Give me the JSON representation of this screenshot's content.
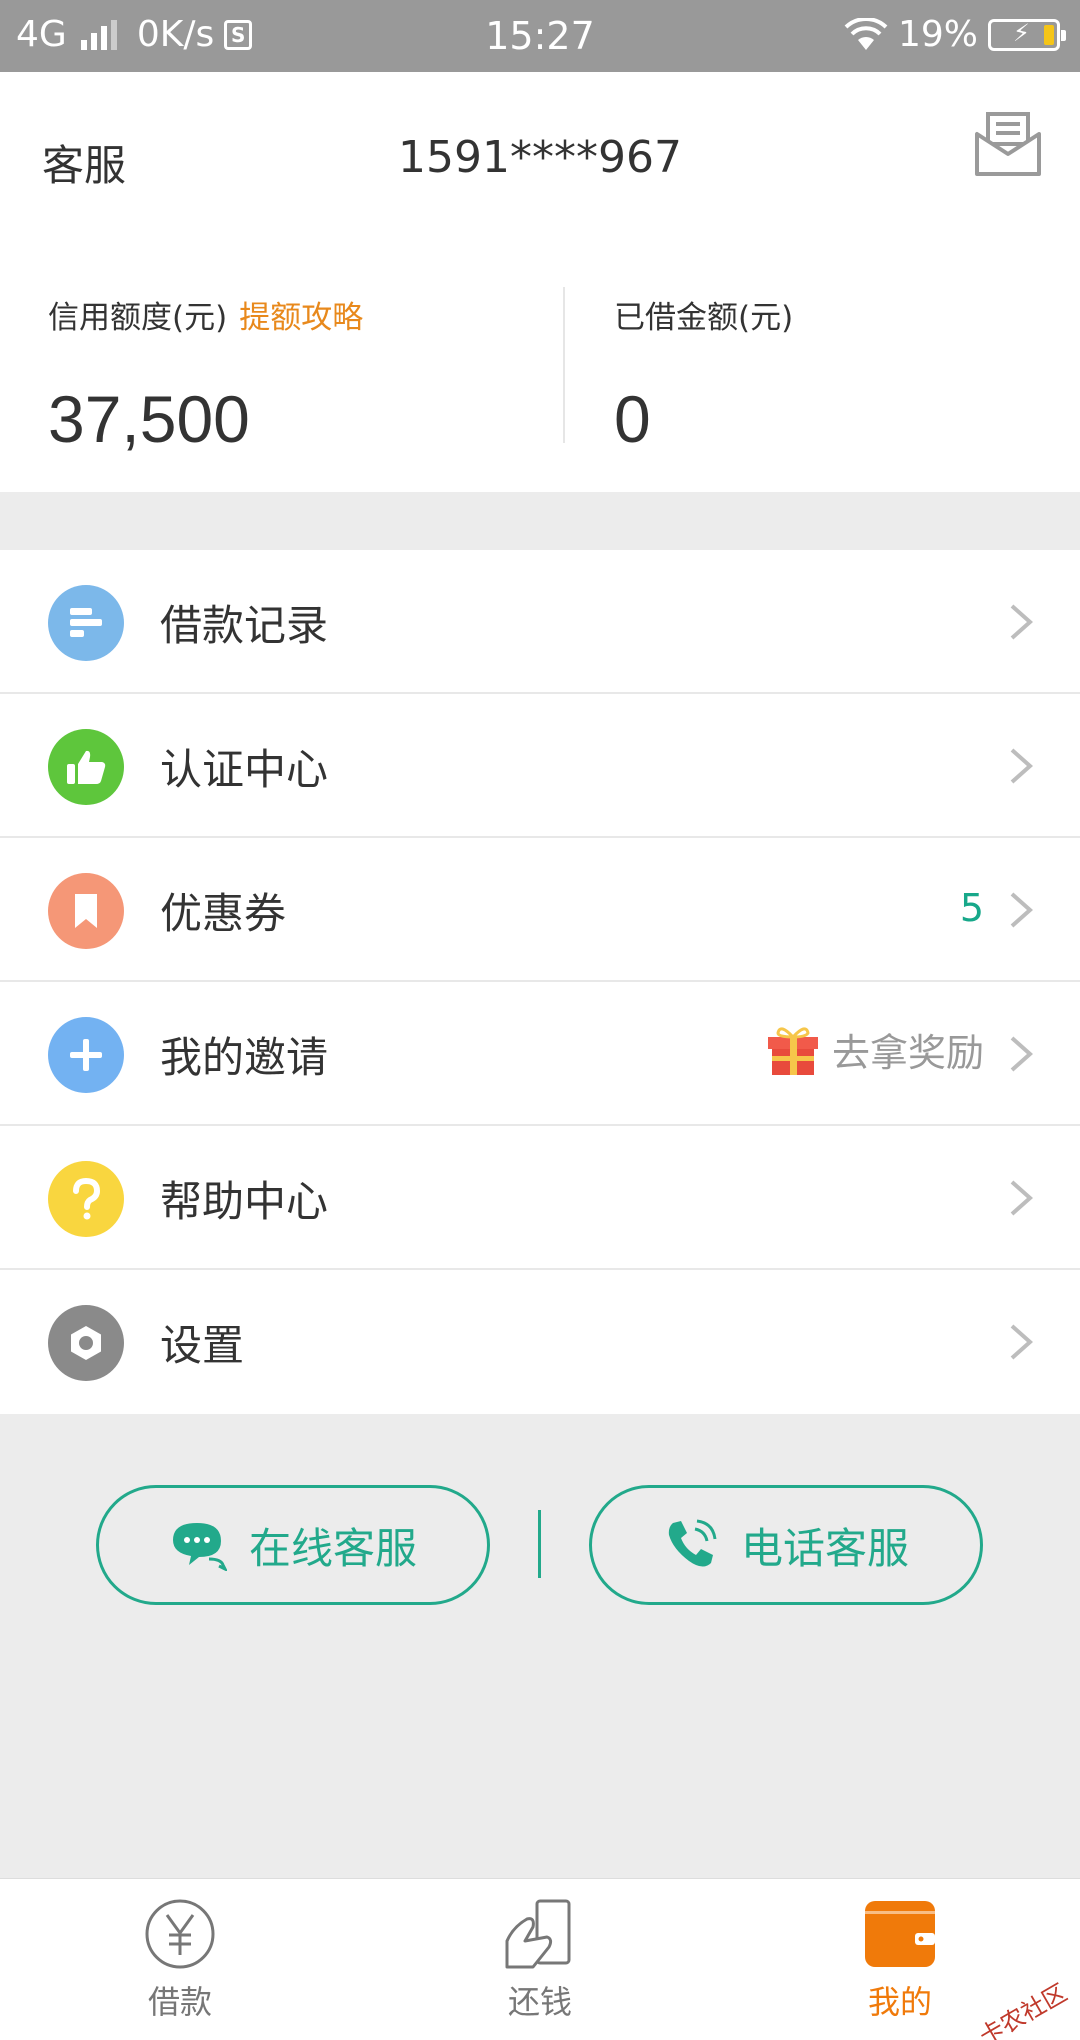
{
  "status_bar": {
    "network": "4G",
    "speed": "0K/s",
    "s_icon": "S",
    "time": "15:27",
    "battery": "19%",
    "battery_level": 0.19
  },
  "header": {
    "service_label": "客服",
    "phone": "1591****967",
    "message_icon": "envelope-icon"
  },
  "credit": {
    "label": "信用额度(元)",
    "link": "提额攻略",
    "amount": "37,500"
  },
  "borrowed": {
    "label": "已借金额(元)",
    "amount": "0"
  },
  "menu": {
    "items": [
      {
        "label": "借款记录",
        "icon": "loan-record-icon",
        "color": "#7cb8ea"
      },
      {
        "label": "认证中心",
        "icon": "thumbs-up-icon",
        "color": "#5ec63c"
      },
      {
        "label": "优惠券",
        "icon": "bookmark-icon",
        "color": "#f59777",
        "count": "5"
      },
      {
        "label": "我的邀请",
        "icon": "plus-icon",
        "color": "#73b2f2",
        "extra": "去拿奖励"
      },
      {
        "label": "帮助中心",
        "icon": "question-icon",
        "color": "#f9d63f"
      },
      {
        "label": "设置",
        "icon": "gear-icon",
        "color": "#8a8a8a"
      }
    ]
  },
  "service": {
    "online": "在线客服",
    "phone": "电话客服",
    "accent": "#22a98b"
  },
  "tabs": [
    {
      "label": "借款",
      "icon": "yuan-icon"
    },
    {
      "label": "还钱",
      "icon": "repay-icon"
    },
    {
      "label": "我的",
      "icon": "wallet-icon",
      "active": true
    }
  ],
  "watermark": "卡农社区"
}
